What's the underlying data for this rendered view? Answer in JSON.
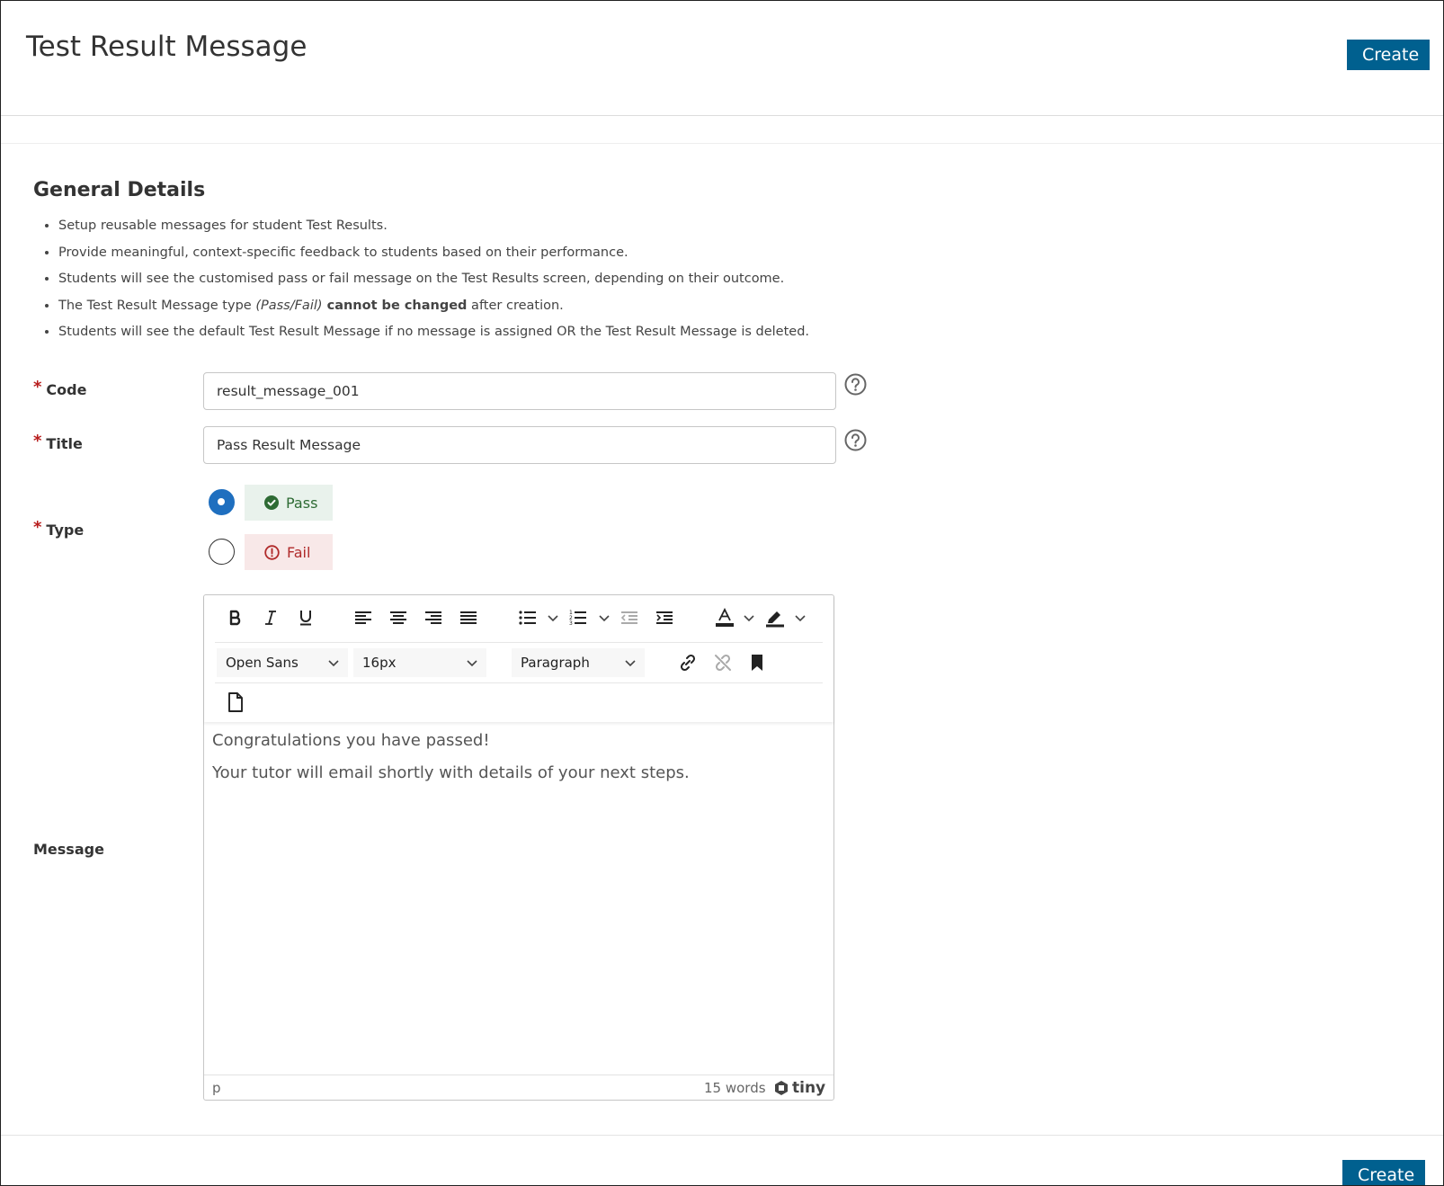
{
  "header": {
    "title": "Test Result Message",
    "create_label": "Create"
  },
  "general": {
    "title": "General Details",
    "bullets": [
      "Setup reusable messages for student Test Results.",
      "Provide meaningful, context-specific feedback to students based on their performance.",
      "Students will see the customised pass or fail message on the Test Results screen, depending on their outcome.",
      "The Test Result Message type (Pass/Fail) cannot be changed after creation.",
      "Students will see the default Test Result Message if no message is assigned OR the Test Result Message is deleted."
    ],
    "bullet4_parts": {
      "a": "The Test Result Message type ",
      "b": "(Pass/Fail)",
      "c": " cannot be changed",
      "d": " after creation."
    }
  },
  "form": {
    "required_mark": "*",
    "code": {
      "label": "Code",
      "value": "result_message_001"
    },
    "title": {
      "label": "Title",
      "value": "Pass Result Message"
    },
    "type": {
      "label": "Type",
      "options": [
        {
          "label": "Pass",
          "selected": true,
          "color": "#2e6b34"
        },
        {
          "label": "Fail",
          "selected": false,
          "color": "#b02a2a"
        }
      ]
    },
    "message": {
      "label": "Message",
      "toolbar": {
        "font_family": "Open Sans",
        "font_size": "16px",
        "block_format": "Paragraph",
        "icons": [
          "bold-icon",
          "italic-icon",
          "underline-icon",
          "align-left-icon",
          "align-center-icon",
          "align-right-icon",
          "align-justify-icon",
          "bullet-list-icon",
          "numbered-list-icon",
          "outdent-icon",
          "indent-icon",
          "text-color-icon",
          "highlight-icon",
          "link-icon",
          "unlink-icon",
          "bookmark-icon",
          "document-icon"
        ]
      },
      "content": [
        "Congratulations you have passed!",
        "Your tutor will email shortly with details of your next steps."
      ],
      "status_path": "p",
      "word_count": "15 words",
      "brand": "tiny"
    }
  },
  "colors": {
    "primary": "#00608f",
    "radio_selected": "#1f6fbf",
    "required": "#b71c1c"
  }
}
